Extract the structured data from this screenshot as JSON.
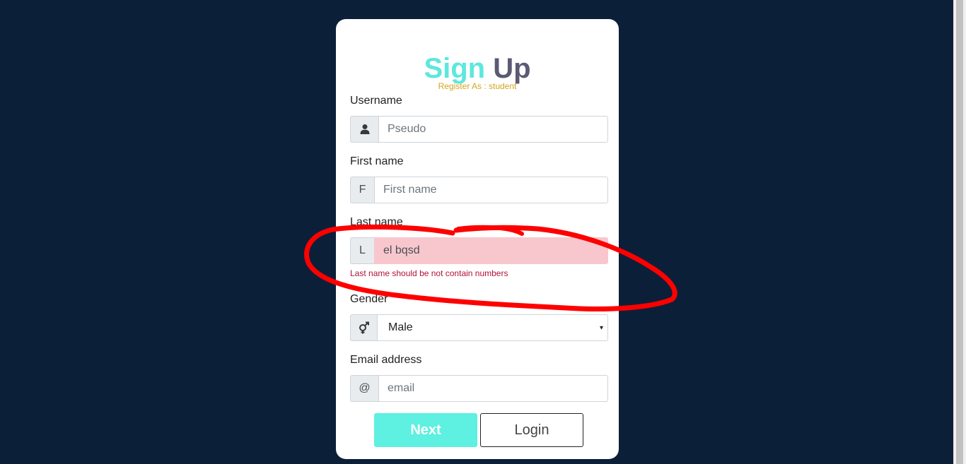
{
  "header": {
    "title_part1": "Sign",
    "title_part2": "Up",
    "register_as": "Register As : student"
  },
  "form": {
    "username": {
      "label": "Username",
      "placeholder": "Pseudo",
      "icon": "user-icon"
    },
    "first_name": {
      "label": "First name",
      "placeholder": "First name",
      "addon": "F"
    },
    "last_name": {
      "label": "Last name",
      "value": "el bqsd",
      "addon": "L",
      "error": "Last name should be not contain numbers"
    },
    "gender": {
      "label": "Gender",
      "selected": "Male",
      "icon": "gender-icon",
      "arrow": "▾"
    },
    "email": {
      "label": "Email address",
      "placeholder": "email",
      "addon": "@"
    }
  },
  "buttons": {
    "next": "Next",
    "login": "Login"
  },
  "colors": {
    "background": "#0c1f39",
    "accent": "#5ce8de",
    "error": "#b0123a",
    "annotation": "#ff0000"
  }
}
